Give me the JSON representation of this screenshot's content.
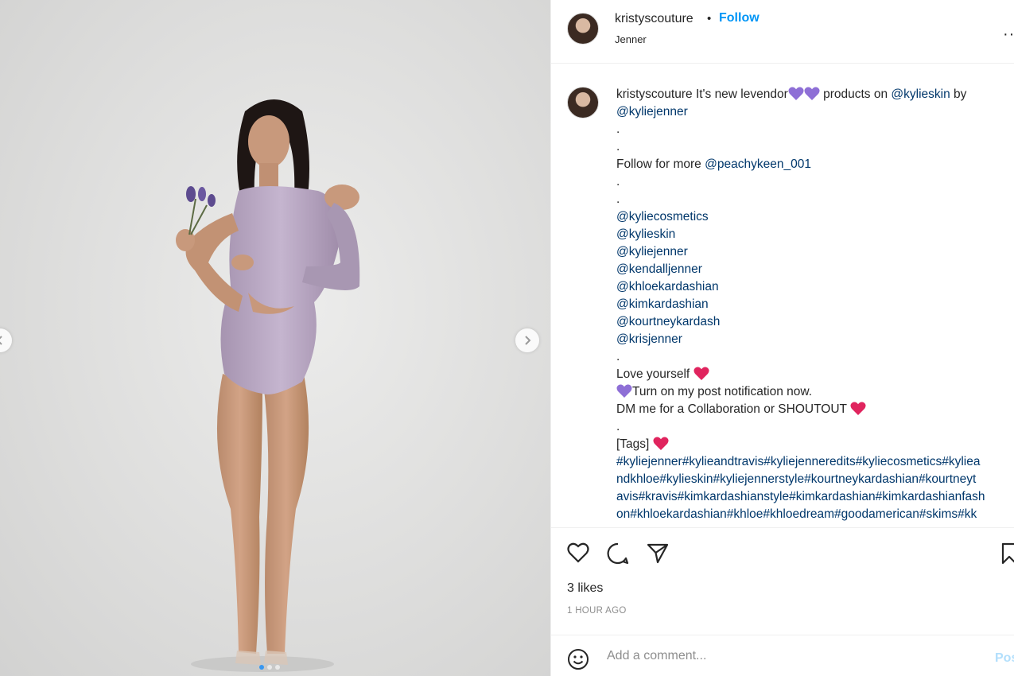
{
  "post": {
    "username": "kristyscouture",
    "separator": "•",
    "follow_label": "Follow",
    "location": "Jenner",
    "more_icon": "more-horizontal-icon"
  },
  "media": {
    "current_slide": 1,
    "total_slides": 3,
    "prev_icon": "chevron-left-icon",
    "next_icon": "chevron-right-icon"
  },
  "caption": {
    "username": "kristyscouture",
    "line1_text": "It's new levendor",
    "line1_tail": "products on",
    "mention_kylieskin": "@kylieskin",
    "by": "by",
    "mention_kyliejenner": "@kyliejenner",
    "dot": ".",
    "follow_text": "Follow for more",
    "mention_peachy": "@peachykeen_001",
    "mentions": [
      "@kyliecosmetics",
      "@kylieskin",
      "@kyliejenner",
      "@kendalljenner",
      "@khloekardashian",
      "@kimkardashian",
      "@kourtneykardash",
      "@krisjenner"
    ],
    "love": "Love yourself",
    "notification": "Turn on my post notification now.",
    "dm": "DM me for a Collaboration or SHOUTOUT",
    "tags_label": "[Tags]",
    "tags_lines": [
      "#kyliejenner#kylieandtravis#kyliejenneredits#kyliecosmetics#kyliea",
      "ndkhloe#kylieskin#kyliejennerstyle#kourtneykardashian#kourtneyt",
      "avis#kravis#kimkardashianstyle#kimkardashian#kimkardashianfash",
      "on#khloekardashian#khloe#khloedream#goodamerican#skims#kk"
    ]
  },
  "engagement": {
    "likes": "3 likes",
    "time": "1 HOUR AGO"
  },
  "comment": {
    "placeholder": "Add a comment...",
    "post_label": "Post"
  },
  "colors": {
    "link": "#00376b",
    "follow": "#0095f6",
    "heart_red": "#e0245e",
    "heart_purple": "#8e6fd6"
  }
}
